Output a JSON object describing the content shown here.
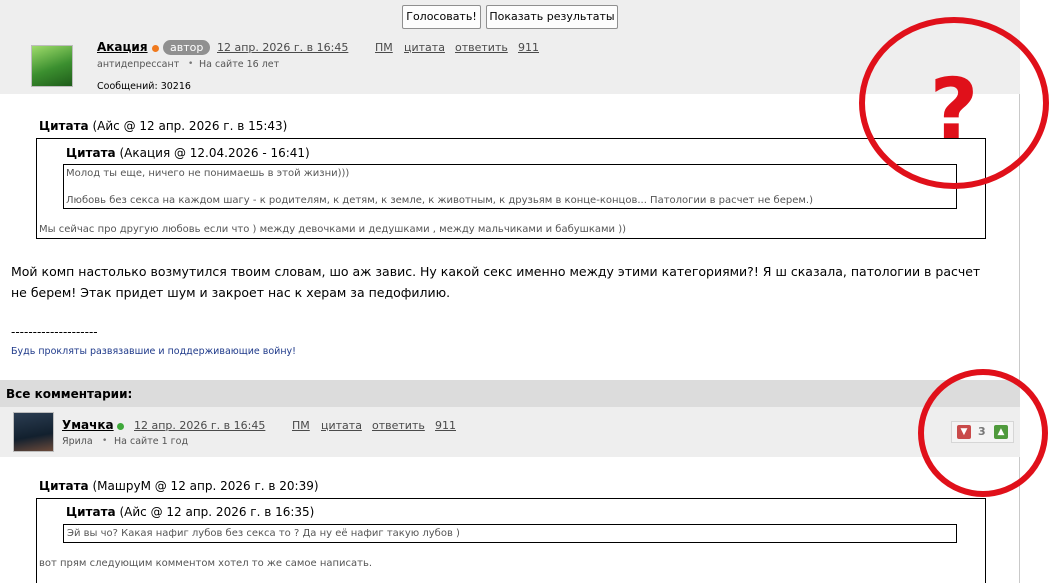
{
  "poll": {
    "vote_label": "Голосовать!",
    "results_label": "Показать результаты"
  },
  "post1": {
    "username": "Акация",
    "badge": "автор",
    "date": "12 апр. 2026 г. в 16:45",
    "links": {
      "pm": "ПМ",
      "quote": "цитата",
      "reply": "ответить",
      "number": "911"
    },
    "status": "антидепрессант",
    "online": "На сайте 16 лет",
    "messages": "Сообщений: 30216",
    "quote_outer": {
      "label_bold": "Цитата",
      "label_rest": "(Айс @ 12 апр. 2026 г. в 15:43)",
      "text": "Мы сейчас про другую любовь если что ) между девочками и дедушками , между мальчиками и бабушками ))"
    },
    "quote_inner": {
      "label_bold": "Цитата",
      "label_rest": "(Акация @ 12.04.2026 - 16:41)",
      "line1": "Молод ты еще, ничего не понимаешь в этой жизни)))",
      "line2": "Любовь без секса на каждом шагу - к родителям, к детям, к земле, к животным, к друзьям в конце-концов... Патологии в расчет не берем.)"
    },
    "body_line1": "Мой комп настолько возмутился твоим словам, шо аж завис. Ну какой секс именно между этими категориями?! Я ш сказала, патологии в расчет",
    "body_line2": "не берем! Этак придет шум и закроет нас к херам за педофилию.",
    "sig_line": "--------------------",
    "sig_text": "Будь прокляты развязавшие и поддерживающие войну!"
  },
  "comments_header": "Все комментарии:",
  "post2": {
    "username": "Умачка",
    "date": "12 апр. 2026 г. в 16:45",
    "links": {
      "pm": "ПМ",
      "quote": "цитата",
      "reply": "ответить",
      "number": "911"
    },
    "status": "Ярила",
    "online": "На сайте 1 год",
    "rating": "3",
    "quote_outer": {
      "label_bold": "Цитата",
      "label_rest": "(МашруМ @ 12 апр. 2026 г. в 20:39)",
      "text": "вот прям следующим комментом хотел то же самое написать."
    },
    "quote_inner": {
      "label_bold": "Цитата",
      "label_rest": "(Айс @ 12 апр. 2026 г. в 16:35)",
      "line1": "Эй вы чо? Какая нафиг лубов без секса то ? Да ну её нафиг такую лубов )"
    }
  },
  "overlay": {
    "mark": "?"
  },
  "colors": {
    "annotation_red": "#e0101a",
    "online_orange": "#f07a1e",
    "online_green": "#3ea83a",
    "badge_gray": "#909090"
  }
}
